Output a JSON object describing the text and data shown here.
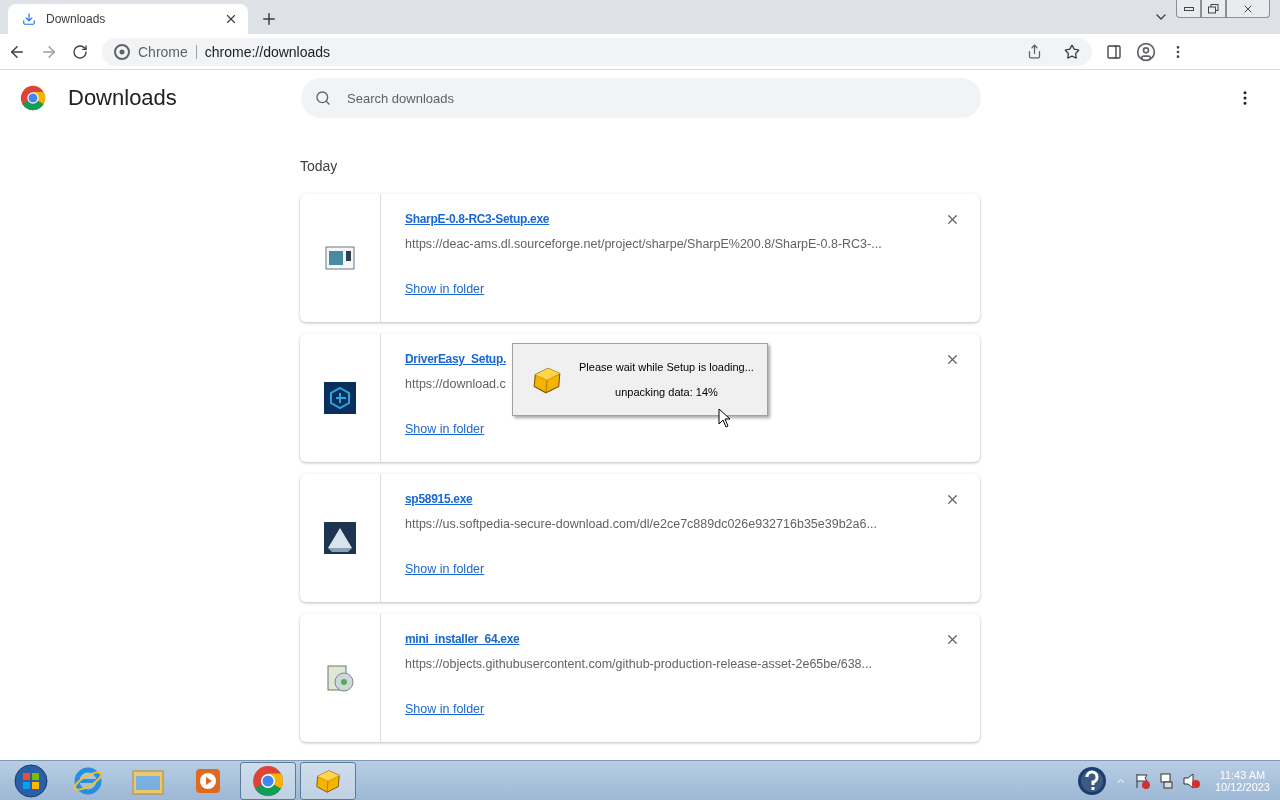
{
  "tab": {
    "title": "Downloads",
    "selected": true
  },
  "omnibox": {
    "site": "Chrome",
    "url": "chrome://downloads"
  },
  "page": {
    "title": "Downloads",
    "search": {
      "placeholder": "Search downloads"
    },
    "section": "Today"
  },
  "downloads": [
    {
      "name": "SharpE-0.8-RC3-Setup.exe",
      "url": "https://deac-ams.dl.sourceforge.net/project/sharpe/SharpE%200.8/SharpE-0.8-RC3-...",
      "action": "Show in folder",
      "kind": "window"
    },
    {
      "name": "DriverEasy_Setup.",
      "url": "https://download.c",
      "action": "Show in folder",
      "kind": "cube"
    },
    {
      "name": "sp58915.exe",
      "url": "https://us.softpedia-secure-download.com/dl/e2ce7c889dc026e932716b35e39b2a6...",
      "action": "Show in folder",
      "kind": "ship"
    },
    {
      "name": "mini_installer_64.exe",
      "url": "https://objects.githubusercontent.com/github-production-release-asset-2e65be/638...",
      "action": "Show in folder",
      "kind": "installer"
    }
  ],
  "dialog": {
    "message": "Please wait while Setup is loading...",
    "progress": "unpacking data: 14%"
  },
  "taskbar": {
    "items": [
      {
        "kind": "ie",
        "running": false
      },
      {
        "kind": "folder",
        "running": false
      },
      {
        "kind": "media",
        "running": false
      },
      {
        "kind": "chrome",
        "running": true
      },
      {
        "kind": "setup",
        "running": true
      }
    ],
    "time": "11:43 AM",
    "date": "10/12/2023"
  }
}
